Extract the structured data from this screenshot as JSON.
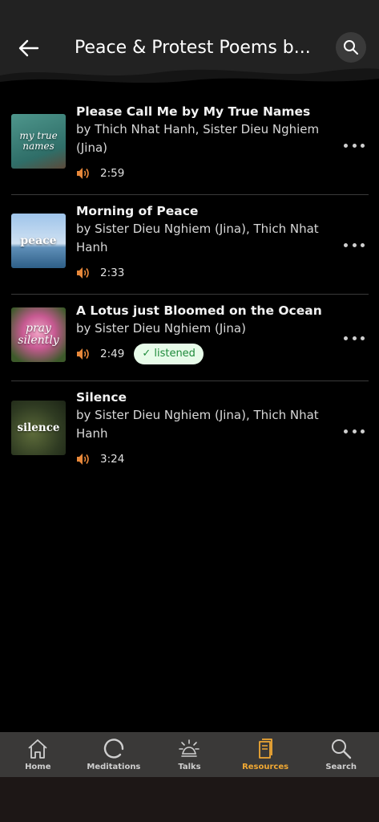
{
  "header": {
    "title": "Peace & Protest Poems b...",
    "back_icon": "arrow-left-icon",
    "search_icon": "search-icon"
  },
  "items": [
    {
      "title": "Please Call Me by My True Names",
      "author": "by Thich Nhat Hanh, Sister Dieu Nghiem (Jina)",
      "duration": "2:59",
      "thumb_text": "my true names",
      "thumb_color": "#3f7f78",
      "listened": false
    },
    {
      "title": "Morning of Peace",
      "author": "by Sister Dieu Nghiem (Jina), Thich Nhat Hanh",
      "duration": "2:33",
      "thumb_text": "peace",
      "thumb_color": "#6f9fcf",
      "listened": false
    },
    {
      "title": "A Lotus just Bloomed on the Ocean",
      "author": "by Sister Dieu Nghiem (Jina)",
      "duration": "2:49",
      "thumb_text": "pray silently",
      "thumb_color": "#c76a9a",
      "listened": true,
      "badge": "✓ listened"
    },
    {
      "title": "Silence",
      "author": "by Sister Dieu Nghiem (Jina), Thich Nhat Hanh",
      "duration": "3:24",
      "thumb_text": "silence",
      "thumb_color": "#3a4a2a",
      "listened": false
    }
  ],
  "nav": [
    {
      "label": "Home",
      "icon": "home-icon",
      "active": false
    },
    {
      "label": "Meditations",
      "icon": "meditation-circle-icon",
      "active": false
    },
    {
      "label": "Talks",
      "icon": "talks-icon",
      "active": false
    },
    {
      "label": "Resources",
      "icon": "resources-book-icon",
      "active": true
    },
    {
      "label": "Search",
      "icon": "search-icon",
      "active": false
    }
  ],
  "colors": {
    "accent": "#f0a833",
    "speaker": "#e8883a",
    "badge_bg": "#e7fbe9",
    "badge_text": "#1e8a3a"
  }
}
